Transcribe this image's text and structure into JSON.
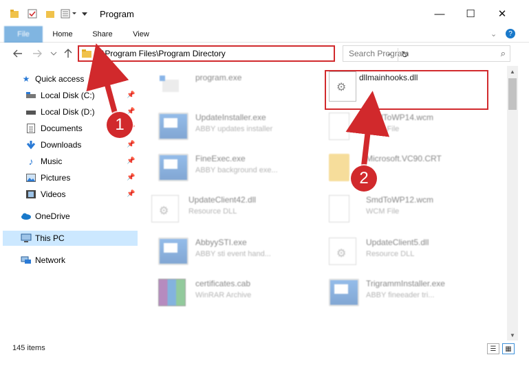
{
  "window": {
    "title": "Program",
    "minimize": "—",
    "maximize": "☐",
    "close": "✕"
  },
  "ribbon": {
    "tabs": [
      {
        "label": "File"
      },
      {
        "label": "Home"
      },
      {
        "label": "Share"
      },
      {
        "label": "View"
      }
    ]
  },
  "address": {
    "path": "C:\\Program Files\\Program Directory"
  },
  "search": {
    "placeholder": "Search Program"
  },
  "sidebar": {
    "items": [
      {
        "label": "Quick access",
        "icon": "star-icon"
      },
      {
        "label": "Local Disk (C:)",
        "icon": "drive-icon"
      },
      {
        "label": "Local Disk (D:)",
        "icon": "drive-icon"
      },
      {
        "label": "Documents",
        "icon": "documents-icon"
      },
      {
        "label": "Downloads",
        "icon": "download-icon"
      },
      {
        "label": "Music",
        "icon": "music-icon"
      },
      {
        "label": "Pictures",
        "icon": "pictures-icon"
      },
      {
        "label": "Videos",
        "icon": "videos-icon"
      },
      {
        "label": "OneDrive",
        "icon": "cloud-icon"
      },
      {
        "label": "This PC",
        "icon": "computer-icon"
      },
      {
        "label": "Network",
        "icon": "network-icon"
      }
    ]
  },
  "files": [
    {
      "name": "program.exe",
      "sub": "",
      "icon": "app-icon"
    },
    {
      "name": "dllmainhooks.dll",
      "sub": "",
      "icon": "gear-file-icon"
    },
    {
      "name": "UpdateInstaller.exe",
      "sub": "ABBY updates installer",
      "icon": "app-icon"
    },
    {
      "name": "SmdToWP14.wcm",
      "sub": "WCM File",
      "icon": "doc-icon"
    },
    {
      "name": "FineExec.exe",
      "sub": "ABBY background exe...",
      "icon": "app-icon"
    },
    {
      "name": "Microsoft.VC90.CRT",
      "sub": "",
      "icon": "folder-icon"
    },
    {
      "name": "UpdateClient42.dll",
      "sub": "Resource DLL",
      "icon": "gear-file-icon"
    },
    {
      "name": "SmdToWP12.wcm",
      "sub": "WCM File",
      "icon": "doc-icon"
    },
    {
      "name": "AbbyySTI.exe",
      "sub": "ABBY sti event hand...",
      "icon": "app-icon"
    },
    {
      "name": "UpdateClient5.dll",
      "sub": "Resource DLL",
      "icon": "gear-file-icon"
    },
    {
      "name": "certificates.cab",
      "sub": "WinRAR Archive",
      "icon": "archive-icon"
    },
    {
      "name": "TrigrammInstaller.exe",
      "sub": "ABBY fineeader tri...",
      "icon": "app-icon"
    }
  ],
  "markers": {
    "one": "1",
    "two": "2"
  },
  "status": {
    "items": "145 items"
  },
  "colors": {
    "accent": "#1979ca",
    "highlight": "#d1292c",
    "selection": "#cce8ff"
  }
}
